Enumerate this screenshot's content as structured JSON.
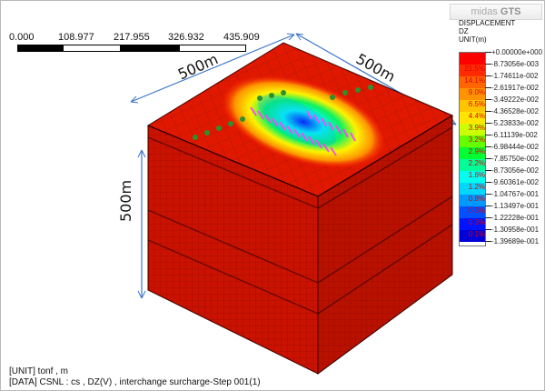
{
  "brand": {
    "left": "midas",
    "right": "GTS"
  },
  "scale": {
    "labels": [
      "0.000",
      "108.977",
      "217.955",
      "326.932",
      "435.909"
    ]
  },
  "legend": {
    "title_lines": [
      "DISPLACEMENT",
      "DZ",
      "UNIT(m)"
    ],
    "values": [
      "+0.00000e+000",
      "-8.73056e-003",
      "-1.74611e-002",
      "-2.61917e-002",
      "-3.49222e-002",
      "-4.36528e-002",
      "-5.23833e-002",
      "-6.11139e-002",
      "-6.98444e-002",
      "-7.85750e-002",
      "-8.73056e-002",
      "-9.60361e-002",
      "-1.04767e-001",
      "-1.13497e-001",
      "-1.22228e-001",
      "-1.30958e-001",
      "-1.39689e-001"
    ],
    "percents": [
      "27.7%",
      "21.5%",
      "14.1%",
      "9.0%",
      "6.5%",
      "4.4%",
      "3.9%",
      "3.2%",
      "2.9%",
      "2.2%",
      "1.6%",
      "1.2%",
      "0.8%",
      "0.5%",
      "0.3%",
      "0.1%"
    ],
    "colors": [
      "#ff0000",
      "#ff2b00",
      "#ff6500",
      "#ff9400",
      "#ffc400",
      "#ffe600",
      "#ccff00",
      "#66ff00",
      "#00ff33",
      "#00ff99",
      "#00ffee",
      "#00d7ff",
      "#0099ff",
      "#0050ff",
      "#0013ff",
      "#0000d8"
    ]
  },
  "dimensions": {
    "top_left": "500m",
    "top_right": "500m",
    "left": "500m"
  },
  "footer": {
    "unit": "[UNIT] tonf , m",
    "data": "[DATA] CSNL : cs ,  DZ(V) , interchange surcharge-Step 001(1)"
  }
}
